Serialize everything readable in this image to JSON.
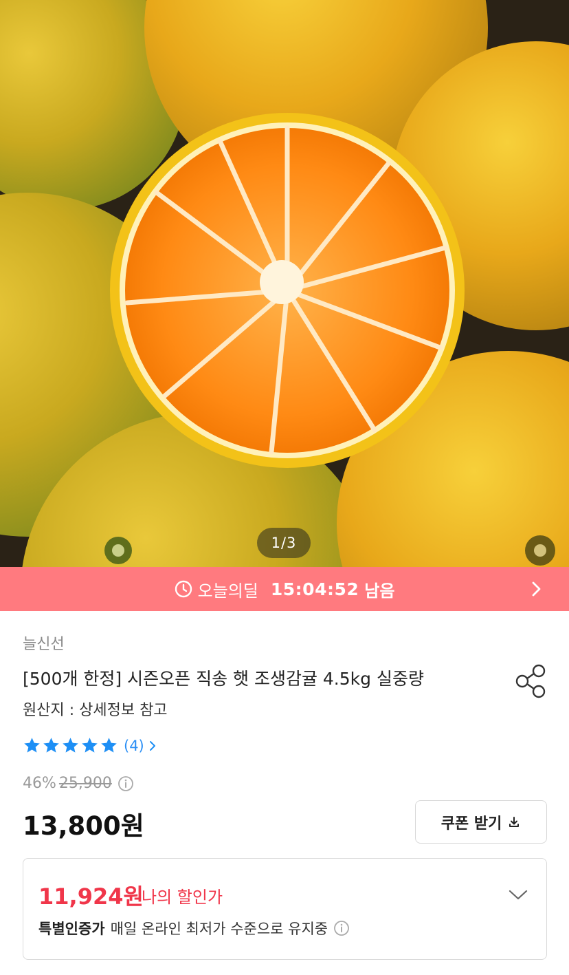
{
  "gallery": {
    "pager_text": "1/3",
    "current": 1,
    "total": 3
  },
  "deal": {
    "label": "오늘의딜",
    "timer": "15:04:52",
    "remain_label": "남음",
    "background_color": "#ff7a7f"
  },
  "product": {
    "brand": "늘신선",
    "title": "[500개 한정] 시즌오픈 직송 햇 조생감귤 4.5kg 실중량",
    "origin": "원산지 : 상세정보 참고",
    "rating": {
      "stars": 5,
      "max_stars": 5,
      "review_count_text": "(4)",
      "star_color": "#1e8ff5"
    },
    "discount_rate": "46%",
    "original_price": "25,900",
    "price": "13,800원",
    "coupon_button_label": "쿠폰 받기"
  },
  "my_price": {
    "price": "11,924원",
    "label": "나의 할인가",
    "special_title": "특별인증가",
    "special_desc": "매일 온라인 최저가 수준으로 유지중",
    "accent_color": "#f0364a"
  },
  "icons": {
    "deal_clock": "clock-icon",
    "deal_arrow": "chevron-right-icon",
    "share": "share-icon",
    "star": "star-icon",
    "review_more": "chevron-right-icon",
    "info": "info-icon",
    "coupon_download": "download-icon",
    "expand": "chevron-down-icon"
  }
}
